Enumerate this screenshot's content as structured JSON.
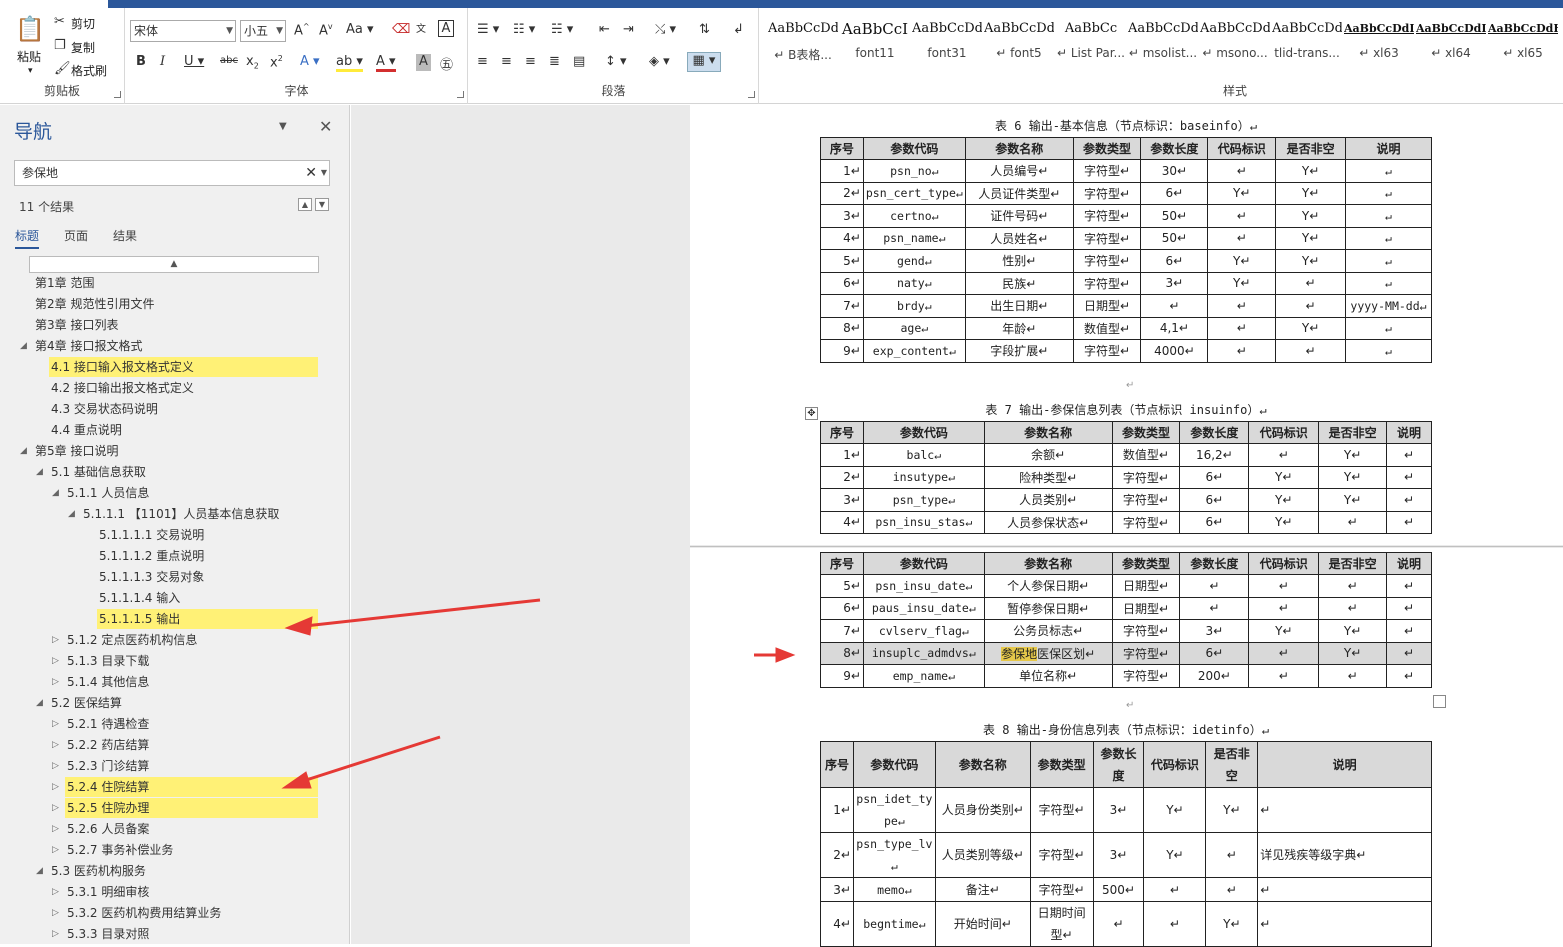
{
  "ribbon": {
    "clipboard": {
      "paste": "粘贴",
      "cut": "剪切",
      "copy": "复制",
      "format_painter": "格式刷",
      "label": "剪贴板"
    },
    "font": {
      "name": "宋体",
      "size": "小五",
      "label": "字体"
    },
    "paragraph": {
      "label": "段落"
    },
    "styles": {
      "label": "样式",
      "items": [
        {
          "preview": "AaBbCcDd",
          "name": "↵ B表格..."
        },
        {
          "preview": "AaBbCcI",
          "name": "font11"
        },
        {
          "preview": "AaBbCcDd",
          "name": "font31"
        },
        {
          "preview": "AaBbCcDdE",
          "name": "↵ font5"
        },
        {
          "preview": "AaBbCc",
          "name": "↵ List Par..."
        },
        {
          "preview": "AaBbCcDd",
          "name": "↵ msolist..."
        },
        {
          "preview": "AaBbCcDd",
          "name": "↵ msono..."
        },
        {
          "preview": "AaBbCcDd",
          "name": "tlid-trans..."
        },
        {
          "preview": "AaBbCcDdI",
          "name": "↵ xl63"
        },
        {
          "preview": "AaBbCcDdI",
          "name": "↵ xl64"
        },
        {
          "preview": "AaBbCcDdEe",
          "name": "↵ xl65"
        }
      ]
    }
  },
  "nav": {
    "title": "导航",
    "search_value": "参保地",
    "result_count": "11 个结果",
    "tabs": [
      "标题",
      "页面",
      "结果"
    ],
    "items": [
      {
        "text": "第1章 范围",
        "level": 0,
        "expander": "",
        "hl": false
      },
      {
        "text": "第2章 规范性引用文件",
        "level": 0,
        "expander": "",
        "hl": false
      },
      {
        "text": "第3章 接口列表",
        "level": 0,
        "expander": "",
        "hl": false
      },
      {
        "text": "第4章 接口报文格式",
        "level": 0,
        "expander": "◢",
        "hl": false
      },
      {
        "text": "4.1 接口输入报文格式定义",
        "level": 1,
        "expander": "",
        "hl": true
      },
      {
        "text": "4.2 接口输出报文格式定义",
        "level": 1,
        "expander": "",
        "hl": false
      },
      {
        "text": "4.3 交易状态码说明",
        "level": 1,
        "expander": "",
        "hl": false
      },
      {
        "text": "4.4 重点说明",
        "level": 1,
        "expander": "",
        "hl": false
      },
      {
        "text": "第5章 接口说明",
        "level": 0,
        "expander": "◢",
        "hl": false
      },
      {
        "text": "5.1 基础信息获取",
        "level": 1,
        "expander": "◢",
        "hl": false
      },
      {
        "text": "5.1.1 人员信息",
        "level": 2,
        "expander": "◢",
        "hl": false
      },
      {
        "text": "5.1.1.1 【1101】人员基本信息获取",
        "level": 3,
        "expander": "◢",
        "hl": false
      },
      {
        "text": "5.1.1.1.1 交易说明",
        "level": 4,
        "expander": "",
        "hl": false
      },
      {
        "text": "5.1.1.1.2 重点说明",
        "level": 4,
        "expander": "",
        "hl": false
      },
      {
        "text": "5.1.1.1.3 交易对象",
        "level": 4,
        "expander": "",
        "hl": false
      },
      {
        "text": "5.1.1.1.4 输入",
        "level": 4,
        "expander": "",
        "hl": false
      },
      {
        "text": "5.1.1.1.5 输出",
        "level": 4,
        "expander": "",
        "hl": true
      },
      {
        "text": "5.1.2 定点医药机构信息",
        "level": 2,
        "expander": "▷",
        "hl": false
      },
      {
        "text": "5.1.3 目录下载",
        "level": 2,
        "expander": "▷",
        "hl": false
      },
      {
        "text": "5.1.4 其他信息",
        "level": 2,
        "expander": "▷",
        "hl": false
      },
      {
        "text": "5.2 医保结算",
        "level": 1,
        "expander": "◢",
        "hl": false
      },
      {
        "text": "5.2.1 待遇检查",
        "level": 2,
        "expander": "▷",
        "hl": false
      },
      {
        "text": "5.2.2 药店结算",
        "level": 2,
        "expander": "▷",
        "hl": false
      },
      {
        "text": "5.2.3 门诊结算",
        "level": 2,
        "expander": "▷",
        "hl": false
      },
      {
        "text": "5.2.4 住院结算",
        "level": 2,
        "expander": "▷",
        "hl": true
      },
      {
        "text": "5.2.5 住院办理",
        "level": 2,
        "expander": "▷",
        "hl": true
      },
      {
        "text": "5.2.6 人员备案",
        "level": 2,
        "expander": "▷",
        "hl": false
      },
      {
        "text": "5.2.7 事务补偿业务",
        "level": 2,
        "expander": "▷",
        "hl": false
      },
      {
        "text": "5.3 医药机构服务",
        "level": 1,
        "expander": "◢",
        "hl": false
      },
      {
        "text": "5.3.1 明细审核",
        "level": 2,
        "expander": "▷",
        "hl": false
      },
      {
        "text": "5.3.2 医药机构费用结算业务",
        "level": 2,
        "expander": "▷",
        "hl": false
      },
      {
        "text": "5.3.3 目录对照",
        "level": 2,
        "expander": "▷",
        "hl": false
      }
    ]
  },
  "doc": {
    "headers8": [
      "序号",
      "参数代码",
      "参数名称",
      "参数类型",
      "参数长度",
      "代码标识",
      "是否非空",
      "说明"
    ],
    "table6": {
      "caption": "表 6 输出-基本信息（节点标识：baseinfo）↵",
      "rows": [
        [
          "1↵",
          "psn_no↵",
          "人员编号↵",
          "字符型↵",
          "30↵",
          "↵",
          "Y↵",
          "↵"
        ],
        [
          "2↵",
          "psn_cert_type↵",
          "人员证件类型↵",
          "字符型↵",
          "6↵",
          "Y↵",
          "Y↵",
          "↵"
        ],
        [
          "3↵",
          "certno↵",
          "证件号码↵",
          "字符型↵",
          "50↵",
          "↵",
          "Y↵",
          "↵"
        ],
        [
          "4↵",
          "psn_name↵",
          "人员姓名↵",
          "字符型↵",
          "50↵",
          "↵",
          "Y↵",
          "↵"
        ],
        [
          "5↵",
          "gend↵",
          "性别↵",
          "字符型↵",
          "6↵",
          "Y↵",
          "Y↵",
          "↵"
        ],
        [
          "6↵",
          "naty↵",
          "民族↵",
          "字符型↵",
          "3↵",
          "Y↵",
          "↵",
          "↵"
        ],
        [
          "7↵",
          "brdy↵",
          "出生日期↵",
          "日期型↵",
          "↵",
          "↵",
          "↵",
          "yyyy-MM-dd↵"
        ],
        [
          "8↵",
          "age↵",
          "年龄↵",
          "数值型↵",
          "4,1↵",
          "↵",
          "Y↵",
          "↵"
        ],
        [
          "9↵",
          "exp_content↵",
          "字段扩展↵",
          "字符型↵",
          "4000↵",
          "↵",
          "↵",
          "↵"
        ]
      ]
    },
    "table7": {
      "caption": "表 7 输出-参保信息列表（节点标识 insuinfo）↵",
      "rows_a": [
        [
          "1↵",
          "balc↵",
          "余额↵",
          "数值型↵",
          "16,2↵",
          "↵",
          "Y↵",
          "↵"
        ],
        [
          "2↵",
          "insutype↵",
          "险种类型↵",
          "字符型↵",
          "6↵",
          "Y↵",
          "Y↵",
          "↵"
        ],
        [
          "3↵",
          "psn_type↵",
          "人员类别↵",
          "字符型↵",
          "6↵",
          "Y↵",
          "Y↵",
          "↵"
        ],
        [
          "4↵",
          "psn_insu_stas↵",
          "人员参保状态↵",
          "字符型↵",
          "6↵",
          "Y↵",
          "↵",
          "↵"
        ]
      ],
      "rows_b": [
        [
          "5↵",
          "psn_insu_date↵",
          "个人参保日期↵",
          "日期型↵",
          "↵",
          "↵",
          "↵",
          "↵"
        ],
        [
          "6↵",
          "paus_insu_date↵",
          "暂停参保日期↵",
          "日期型↵",
          "↵",
          "↵",
          "↵",
          "↵"
        ],
        [
          "7↵",
          "cvlserv_flag↵",
          "公务员标志↵",
          "字符型↵",
          "3↵",
          "Y↵",
          "Y↵",
          "↵"
        ],
        [
          "8↵",
          "insuplc_admdvs↵",
          "参保地医保区划↵",
          "字符型↵",
          "6↵",
          "↵",
          "Y↵",
          "↵"
        ],
        [
          "9↵",
          "emp_name↵",
          "单位名称↵",
          "字符型↵",
          "200↵",
          "↵",
          "↵",
          "↵"
        ]
      ]
    },
    "table8": {
      "caption": "表 8 输出-身份信息列表（节点标识：idetinfo）↵",
      "headers": [
        "序号",
        "参数代码",
        "参数名称",
        "参数类型",
        "参数长度",
        "代码标识",
        "是否非空",
        "说明"
      ],
      "rows": [
        [
          "1↵",
          "psn_idet_type↵",
          "人员身份类别↵",
          "字符型↵",
          "3↵",
          "Y↵",
          "Y↵",
          "↵"
        ],
        [
          "2↵",
          "psn_type_lv↵",
          "人员类别等级↵",
          "字符型↵",
          "3↵",
          "Y↵",
          "↵",
          "详见残疾等级字典↵"
        ],
        [
          "3↵",
          "memo↵",
          "备注↵",
          "字符型↵",
          "500↵",
          "↵",
          "↵",
          "↵"
        ],
        [
          "4↵",
          "begntime↵",
          "开始时间↵",
          "日期时间型↵",
          "↵",
          "↵",
          "Y↵",
          "↵"
        ]
      ]
    },
    "search_highlight": "参保地"
  },
  "colors": {
    "accent": "#2b579a",
    "search_hl": "#fff176",
    "arrow": "#e53935",
    "header_fill": "#d9d9d9"
  }
}
